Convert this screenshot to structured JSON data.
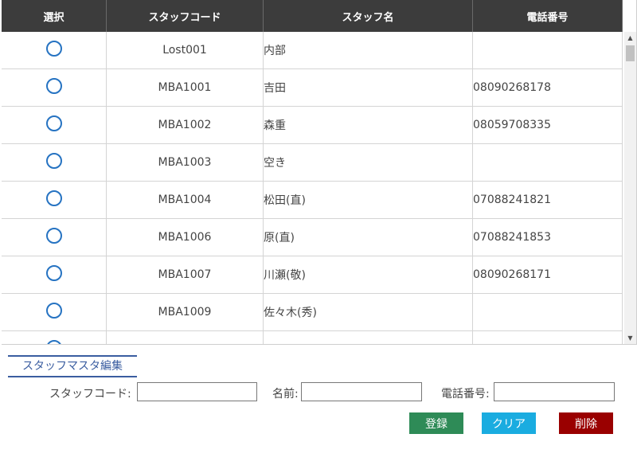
{
  "grid": {
    "headers": {
      "select": "選択",
      "code": "スタッフコード",
      "name": "スタッフ名",
      "tel": "電話番号"
    },
    "rows": [
      {
        "code": "Lost001",
        "name": "内部",
        "tel": ""
      },
      {
        "code": "MBA1001",
        "name": "吉田",
        "tel": "08090268178"
      },
      {
        "code": "MBA1002",
        "name": "森重",
        "tel": "08059708335"
      },
      {
        "code": "MBA1003",
        "name": "空き",
        "tel": ""
      },
      {
        "code": "MBA1004",
        "name": "松田(直)",
        "tel": "07088241821"
      },
      {
        "code": "MBA1006",
        "name": "原(直)",
        "tel": "07088241853"
      },
      {
        "code": "MBA1007",
        "name": "川瀬(敬)",
        "tel": "08090268171"
      },
      {
        "code": "MBA1009",
        "name": "佐々木(秀)",
        "tel": ""
      },
      {
        "code": "",
        "name": "",
        "tel": ""
      }
    ]
  },
  "editor": {
    "title": "スタッフマスタ編集",
    "code_label": "スタッフコード:",
    "name_label": "名前:",
    "tel_label": "電話番号:",
    "code_value": "",
    "name_value": "",
    "tel_value": ""
  },
  "buttons": {
    "register": "登録",
    "clear": "クリア",
    "delete": "削除"
  }
}
